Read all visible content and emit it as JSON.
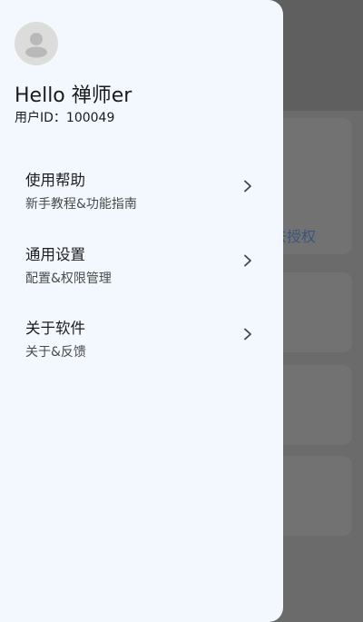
{
  "background": {
    "link_text": "去授权"
  },
  "drawer": {
    "greeting": "Hello 禅师er",
    "user_id": "用户ID：100049",
    "menu": [
      {
        "title": "使用帮助",
        "subtitle": "新手教程&功能指南",
        "icon": "chevron-right-icon"
      },
      {
        "title": "通用设置",
        "subtitle": "配置&权限管理",
        "icon": "chevron-right-icon"
      },
      {
        "title": "关于软件",
        "subtitle": "关于&反馈",
        "icon": "chevron-right-icon"
      }
    ]
  },
  "colors": {
    "drawer_bg": "#f3f8fe",
    "scrim": "#6b6b6b",
    "avatar_bg": "#dcdcdc",
    "text_primary": "#1e1e1e",
    "text_secondary": "#4a4a4a",
    "link_muted": "#3a557d"
  }
}
